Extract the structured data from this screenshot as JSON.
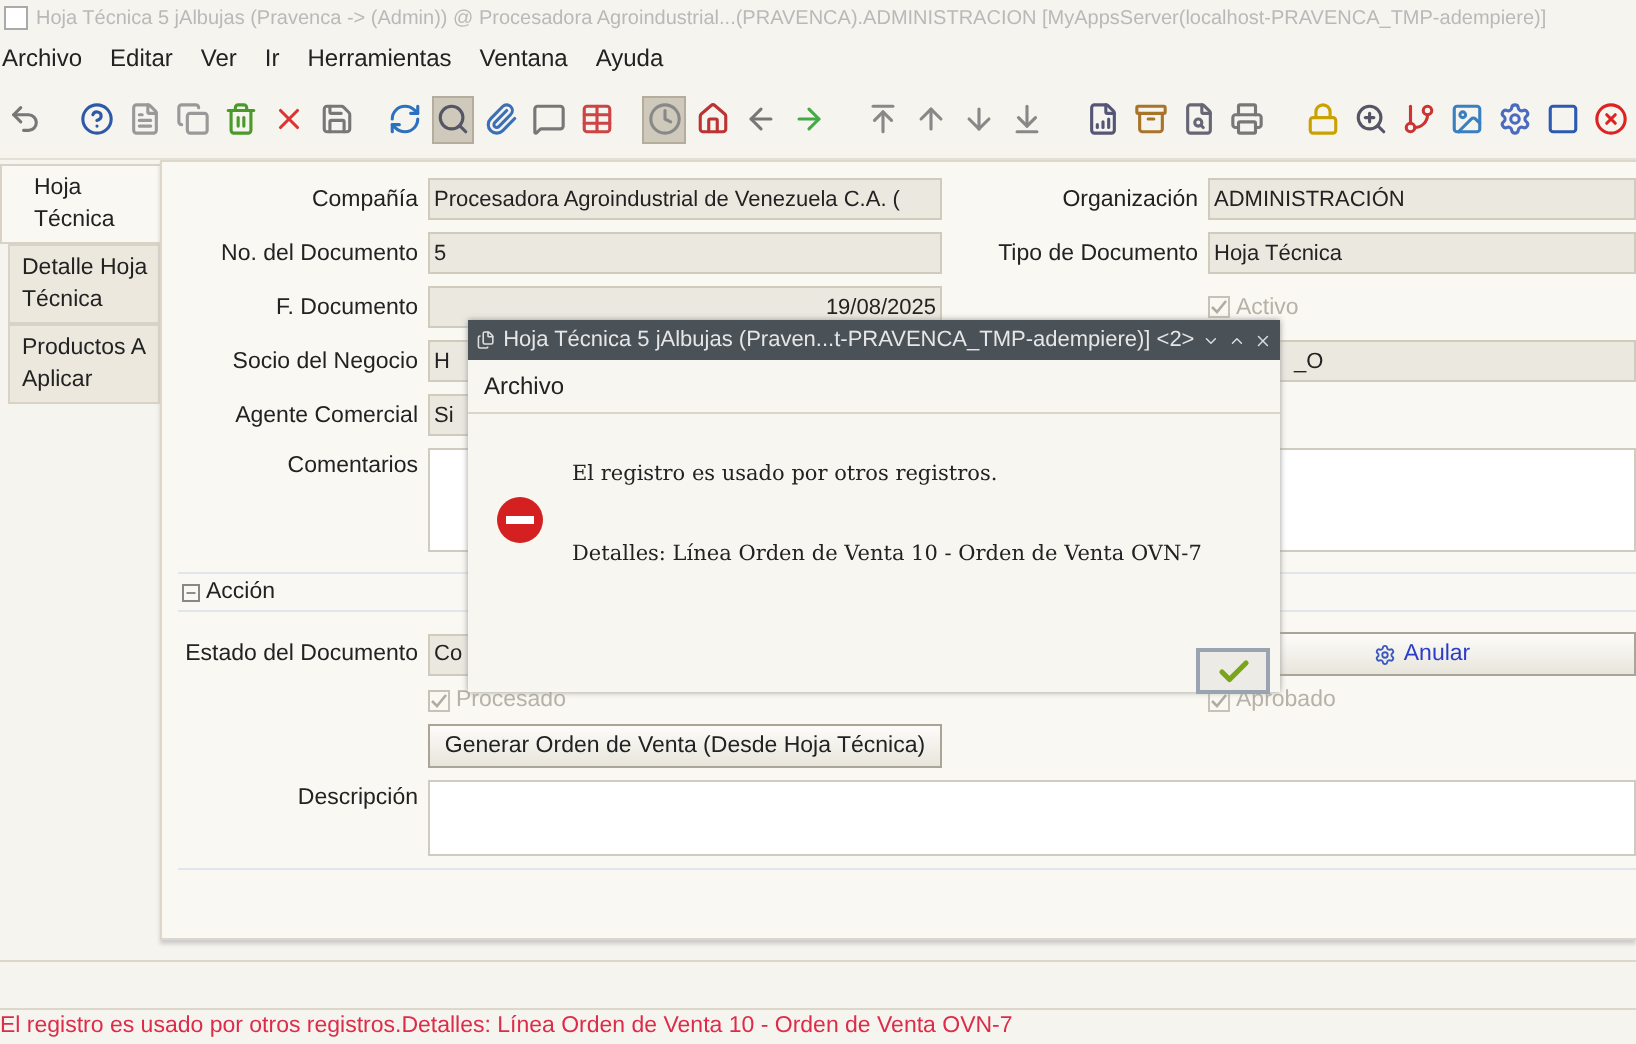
{
  "window": {
    "title": "Hoja Técnica 5 jAlbujas (Pravenca -> (Admin)) @ Procesadora Agroindustrial...(PRAVENCA).ADMINISTRACION [MyAppsServer(localhost-PRAVENCA_TMP-adempiere)]"
  },
  "menu": [
    {
      "label": "Archivo"
    },
    {
      "label": "Editar"
    },
    {
      "label": "Ver"
    },
    {
      "label": "Ir"
    },
    {
      "label": "Herramientas"
    },
    {
      "label": "Ventana"
    },
    {
      "label": "Ayuda"
    }
  ],
  "toolbar": [
    {
      "selected": false
    },
    {
      "selected": false
    },
    {
      "selected": false
    },
    {
      "selected": false
    },
    {
      "selected": false
    },
    {
      "selected": false
    },
    {
      "selected": false
    },
    {
      "selected": false
    },
    {
      "selected": true
    },
    {
      "selected": false
    },
    {
      "selected": false
    },
    {
      "selected": false
    },
    {
      "selected": true
    },
    {
      "selected": false
    },
    {
      "selected": false
    },
    {
      "selected": false
    },
    {
      "selected": false
    },
    {
      "selected": false
    },
    {
      "selected": false
    },
    {
      "selected": false
    },
    {
      "selected": false
    },
    {
      "selected": false
    },
    {
      "selected": false
    },
    {
      "selected": false
    },
    {
      "selected": false
    },
    {
      "selected": false
    },
    {
      "selected": false
    },
    {
      "selected": false
    },
    {
      "selected": false
    },
    {
      "selected": false
    },
    {
      "selected": false
    }
  ],
  "tabs": [
    {
      "label": "Hoja Técnica",
      "selected": true
    },
    {
      "label": "Detalle Hoja Técnica",
      "selected": false
    },
    {
      "label": "Productos A Aplicar",
      "selected": false
    }
  ],
  "form": {
    "company": {
      "label": "Compañía",
      "value": "Procesadora Agroindustrial de Venezuela C.A. ("
    },
    "organization": {
      "label": "Organización",
      "value": "ADMINISTRACIÓN"
    },
    "document_no": {
      "label": "No. del Documento",
      "value": "5"
    },
    "document_type": {
      "label": "Tipo de Documento",
      "value": "Hoja Técnica"
    },
    "document_date": {
      "label": "F. Documento",
      "value": "19/08/2025"
    },
    "active": {
      "label": "Activo",
      "checked": true
    },
    "business_partner": {
      "label": "Socio del Negocio",
      "value": "H"
    },
    "field_right": {
      "value": "_O"
    },
    "sales_agent": {
      "label": "Agente Comercial",
      "value": "Si"
    },
    "comments": {
      "label": "Comentarios"
    },
    "section": {
      "label": "Acción",
      "expanded": true
    },
    "document_status": {
      "label": "Estado del Documento",
      "value": "Co"
    },
    "void_button": {
      "label": "Anular"
    },
    "processed": {
      "label": "Procesado",
      "checked": true
    },
    "approved": {
      "label": "Aprobado",
      "checked": true
    },
    "generate_button": {
      "label": "Generar Orden de Venta (Desde Hoja Técnica)"
    },
    "description": {
      "label": "Descripción"
    }
  },
  "dialog": {
    "title": "Hoja Técnica 5 jAlbujas (Praven...t-PRAVENCA_TMP-adempiere)] <2>",
    "menu": "Archivo",
    "message": "El registro es usado por otros registros.",
    "details": "Detalles: Línea Orden de Venta 10 - Orden de Venta OVN-7"
  },
  "status_bar": {
    "message": "El registro es usado por otros registros.Detalles:  Línea Orden de Venta 10 - Orden de Venta OVN-7"
  }
}
